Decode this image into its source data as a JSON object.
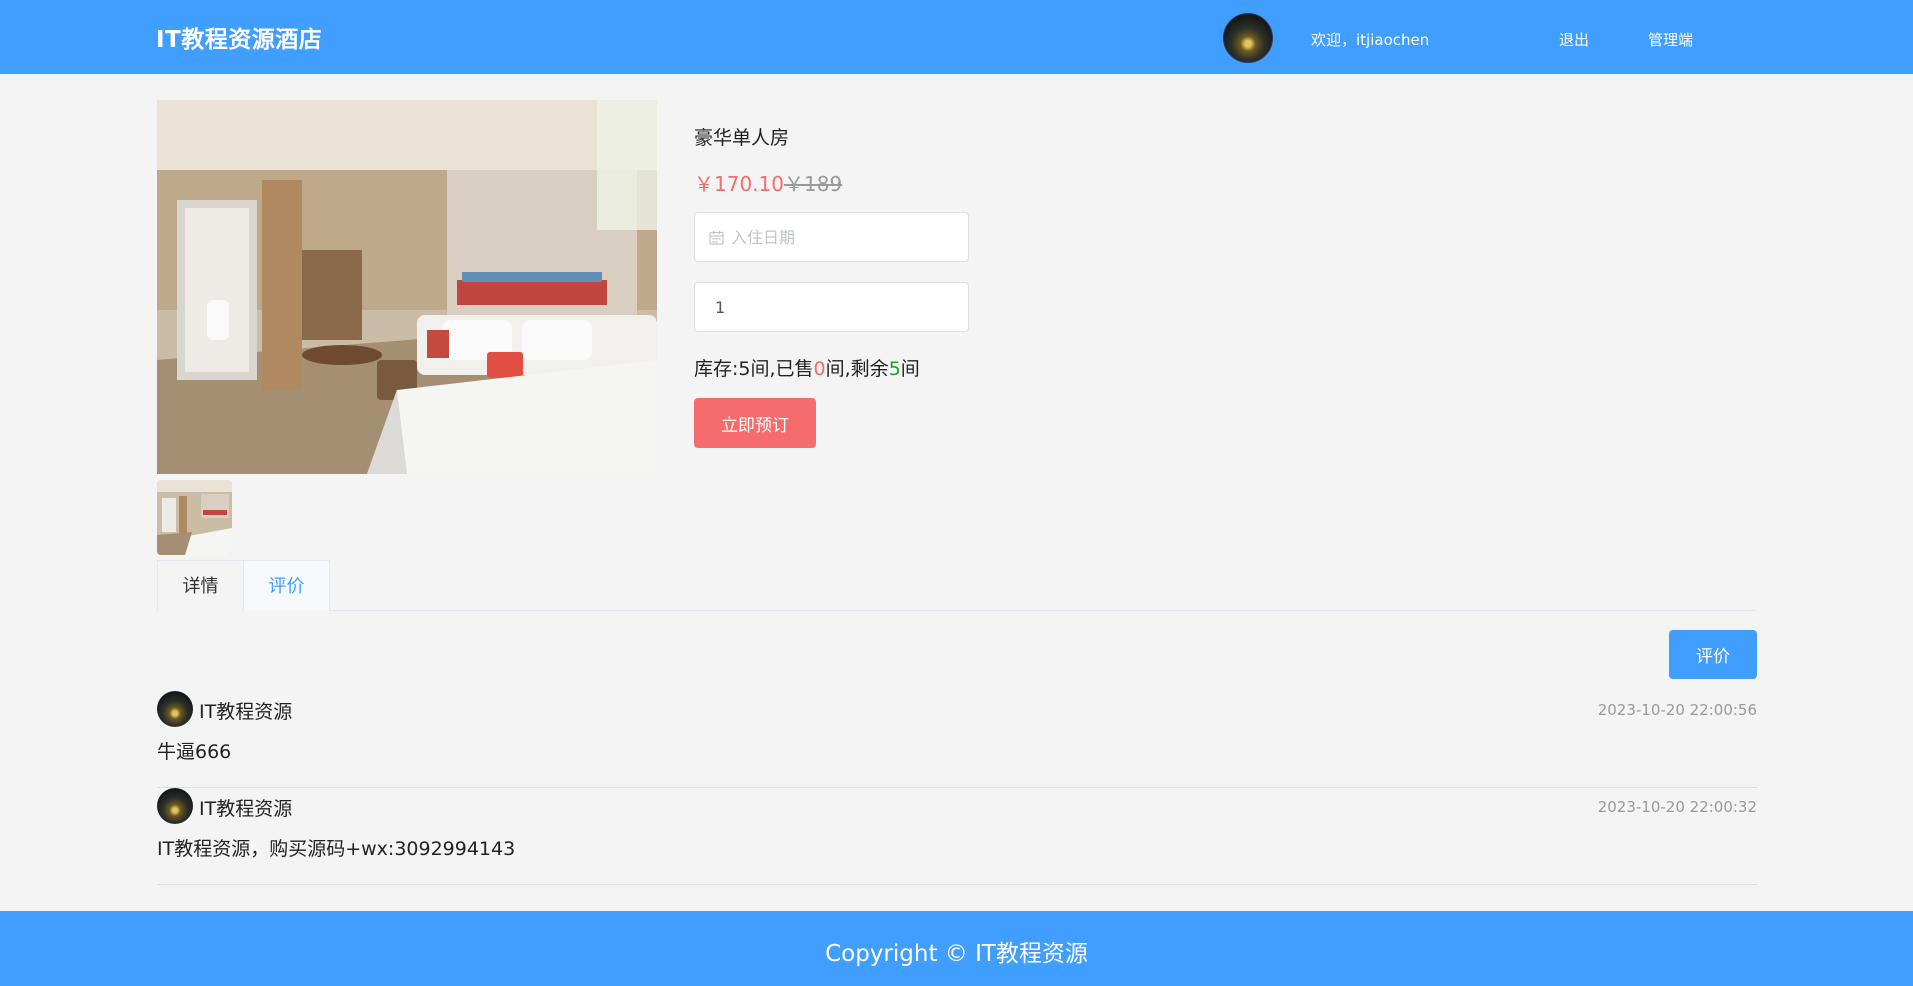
{
  "header": {
    "brand": "IT教程资源酒店",
    "welcome": "欢迎，itjiaochen",
    "logout": "退出",
    "admin": "管理端"
  },
  "room": {
    "name": "豪华单人房",
    "price_now": "￥170.10",
    "price_old": "￥189",
    "date_placeholder": "入住日期",
    "quantity": "1",
    "stock": {
      "prefix": "库存:",
      "total": "5",
      "sold_label": "间,已售",
      "sold": "0",
      "remain_label": "间,剩余",
      "remain": "5",
      "suffix": "间"
    },
    "book_button": "立即预订"
  },
  "tabs": [
    {
      "label": "详情",
      "active": false
    },
    {
      "label": "评价",
      "active": true
    }
  ],
  "review_button": "评价",
  "comments": [
    {
      "user": "IT教程资源",
      "time": "2023-10-20 22:00:56",
      "text": "牛逼666"
    },
    {
      "user": "IT教程资源",
      "time": "2023-10-20 22:00:32",
      "text": "IT教程资源，购买源码+wx:3092994143"
    }
  ],
  "footer": {
    "copyright": "Copyright © IT教程资源"
  },
  "colors": {
    "primary": "#409eff",
    "danger": "#f56c6c",
    "success": "#1b9e2c",
    "background": "#f4f4f4"
  },
  "icons": {
    "date": "calendar-icon"
  }
}
